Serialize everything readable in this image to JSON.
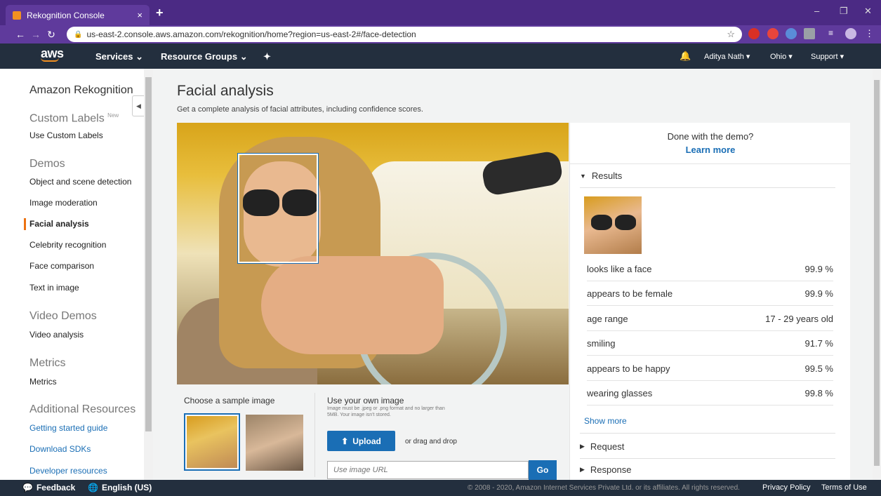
{
  "browser": {
    "tab_title": "Rekognition Console",
    "tab_close": "×",
    "new_tab": "+",
    "url": "us-east-2.console.aws.amazon.com/rekognition/home?region=us-east-2#/face-detection",
    "window_controls": [
      "–",
      "❐",
      "✕"
    ]
  },
  "aws_nav": {
    "logo": "aws",
    "services": "Services ⌄",
    "resource_groups": "Resource Groups ⌄",
    "user": "Aditya Nath ▾",
    "region": "Ohio ▾",
    "support": "Support ▾"
  },
  "sidebar": {
    "title": "Amazon Rekognition",
    "custom_labels_head": "Custom Labels",
    "new_badge": "New",
    "use_custom_labels": "Use Custom Labels",
    "demos_head": "Demos",
    "demos": [
      "Object and scene detection",
      "Image moderation",
      "Facial analysis",
      "Celebrity recognition",
      "Face comparison",
      "Text in image"
    ],
    "video_demos_head": "Video Demos",
    "video_analysis": "Video analysis",
    "metrics_head": "Metrics",
    "metrics": "Metrics",
    "additional_head": "Additional Resources",
    "resources": [
      "Getting started guide",
      "Download SDKs",
      "Developer resources"
    ]
  },
  "main": {
    "title": "Facial analysis",
    "subtitle": "Get a complete analysis of facial attributes, including confidence scores.",
    "sample_label": "Choose a sample image",
    "own_label": "Use your own image",
    "own_note": "Image must be .jpeg or .png format and no larger than 5MB. Your image isn't stored.",
    "upload": "Upload",
    "drag": "or drag and drop",
    "url_placeholder": "Use image URL",
    "go": "Go"
  },
  "panel": {
    "demo_question": "Done with the demo?",
    "learn_more": "Learn more",
    "results_head": "Results",
    "results": [
      {
        "label": "looks like a face",
        "value": "99.9 %"
      },
      {
        "label": "appears to be female",
        "value": "99.9 %"
      },
      {
        "label": "age range",
        "value": "17 - 29 years old"
      },
      {
        "label": "smiling",
        "value": "91.7 %"
      },
      {
        "label": "appears to be happy",
        "value": "99.5 %"
      },
      {
        "label": "wearing glasses",
        "value": "99.8 %"
      }
    ],
    "show_more": "Show more",
    "request": "Request",
    "response": "Response"
  },
  "footer": {
    "feedback": "Feedback",
    "language": "English (US)",
    "copyright": "© 2008 - 2020, Amazon Internet Services Private Ltd. or its affiliates. All rights reserved.",
    "privacy": "Privacy Policy",
    "terms": "Terms of Use"
  },
  "colors": {
    "accent": "#1a6eb5",
    "nav_bg": "#232f3e",
    "active_marker": "#ec7211",
    "browser_frame": "#4b2a84"
  }
}
